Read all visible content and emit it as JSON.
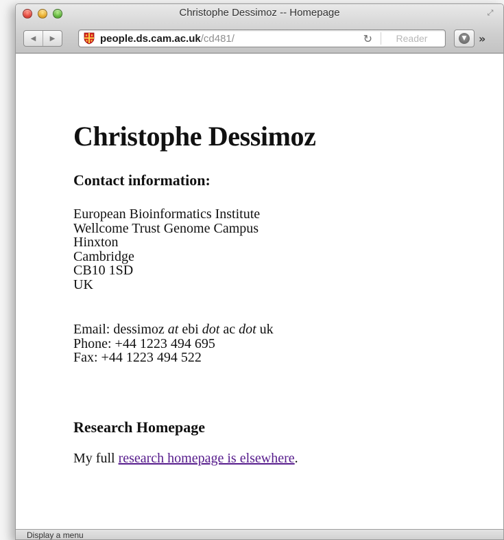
{
  "window": {
    "title": "Christophe Dessimoz -- Homepage"
  },
  "toolbar": {
    "back_icon": "back-arrow-icon",
    "forward_icon": "forward-arrow-icon",
    "url_host": "people.ds.cam.ac.uk",
    "url_path": "/cd481/",
    "reload_icon": "reload-icon",
    "reader_label": "Reader",
    "download_icon": "download-icon",
    "overflow_label": "»"
  },
  "page": {
    "title": "Christophe Dessimoz",
    "contact_heading": "Contact information:",
    "address_lines": [
      "European Bioinformatics Institute",
      "Wellcome Trust Genome Campus",
      "Hinxton",
      "Cambridge",
      "CB10 1SD",
      "UK"
    ],
    "email_prefix": "Email: dessimoz ",
    "email_at": "at",
    "email_mid1": " ebi ",
    "email_dot1": "dot",
    "email_mid2": " ac ",
    "email_dot2": "dot",
    "email_suffix": " uk",
    "phone": "Phone: +44 1223 494 695",
    "fax": "Fax: +44 1223 494 522",
    "research_heading": "Research Homepage",
    "research_prefix": "My full ",
    "research_link": "research homepage is elsewhere",
    "research_suffix": "."
  },
  "statusbar": {
    "text": "Display a menu"
  },
  "colors": {
    "link_visited": "#551a8b"
  }
}
